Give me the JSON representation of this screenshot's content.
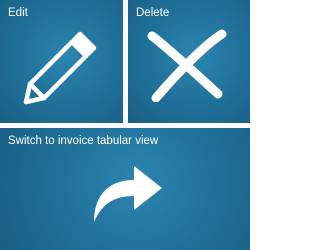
{
  "tiles": {
    "edit": {
      "label": "Edit",
      "icon": "pencil-icon"
    },
    "delete": {
      "label": "Delete",
      "icon": "close-x-icon"
    },
    "switch": {
      "label": "Switch to invoice tabular view",
      "icon": "curved-arrow-right-icon"
    }
  },
  "colors": {
    "tile_background": "#1f6f98",
    "tile_foreground": "#ffffff",
    "gap": "#ffffff"
  }
}
